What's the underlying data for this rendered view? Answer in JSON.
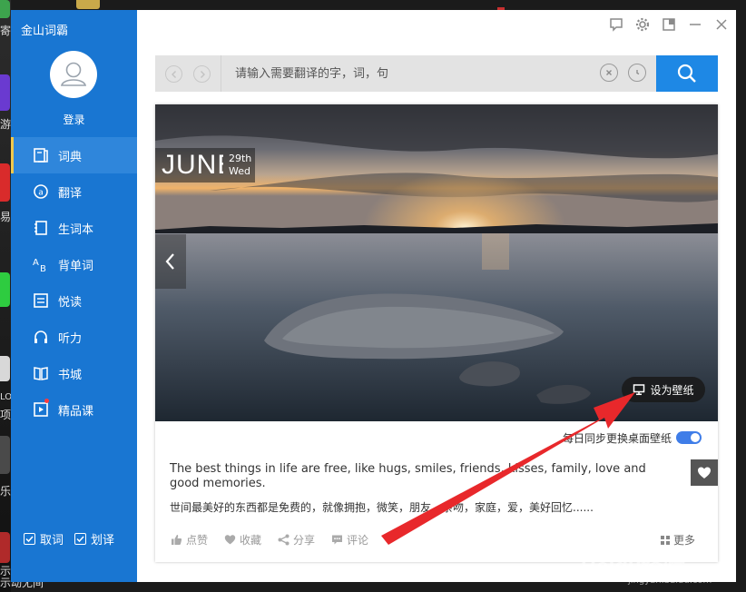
{
  "desktop": {
    "fragments": [
      "寄",
      "游",
      "易",
      "LO",
      "项",
      "乐",
      "示"
    ],
    "bottom_text": "示动无间"
  },
  "app": {
    "title": "金山词霸",
    "login_label": "登录"
  },
  "sidebar": {
    "items": [
      {
        "label": "词典",
        "icon": "book-icon",
        "active": true
      },
      {
        "label": "翻译",
        "icon": "translate-icon"
      },
      {
        "label": "生词本",
        "icon": "notebook-icon"
      },
      {
        "label": "背单词",
        "icon": "ab-icon"
      },
      {
        "label": "悦读",
        "icon": "reading-icon"
      },
      {
        "label": "听力",
        "icon": "headphones-icon"
      },
      {
        "label": "书城",
        "icon": "open-book-icon"
      },
      {
        "label": "精品课",
        "icon": "play-course-icon",
        "badge": true
      }
    ],
    "options": [
      {
        "label": "取词",
        "checked": true
      },
      {
        "label": "划译",
        "checked": true
      }
    ]
  },
  "titlebar": {
    "buttons": [
      "feedback-icon",
      "settings-icon",
      "mini-mode-icon",
      "minimize-icon",
      "close-icon"
    ]
  },
  "search": {
    "placeholder": "请输入需要翻译的字，词，句",
    "value": ""
  },
  "daily": {
    "month": "JUNE",
    "day": "29th",
    "weekday": "Wed",
    "set_wallpaper_label": "设为壁纸",
    "sync_label": "每日同步更换桌面壁纸",
    "sync_enabled": true,
    "quote_en": "The best things in life are free, like hugs, smiles, friends, kisses, family, love and good memories.",
    "quote_cn": "世间最美好的东西都是免费的，就像拥抱，微笑，朋友，亲吻，家庭，爱，美好回忆......",
    "actions": [
      {
        "label": "点赞",
        "icon": "thumbs-up-icon"
      },
      {
        "label": "收藏",
        "icon": "heart-icon"
      },
      {
        "label": "分享",
        "icon": "share-icon"
      },
      {
        "label": "评论",
        "icon": "comment-icon"
      }
    ],
    "more_label": "更多"
  },
  "colors": {
    "sidebar_bg": "#1976d2",
    "accent_blue": "#1e88e5",
    "arrow_red": "#e8282b"
  },
  "watermark": {
    "brand": "Baidu经验",
    "url": "jingyan.baidu.com"
  }
}
